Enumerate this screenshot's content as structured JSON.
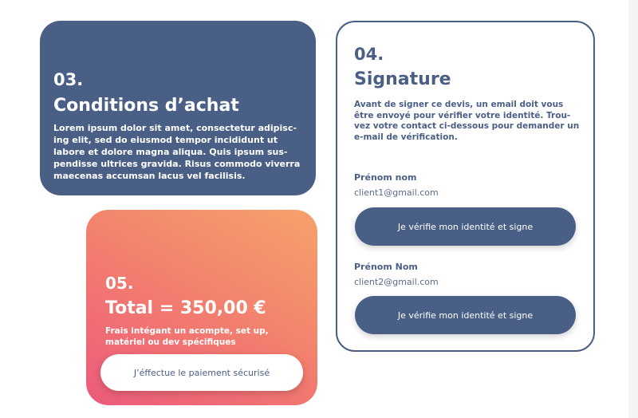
{
  "conditions": {
    "number": "03.",
    "title": "Conditions d’achat",
    "body": "Lorem ipsum dolor sit amet, consectetur adipisc-ing elit, sed do eiusmod tempor incididunt ut labore et dolore magna aliqua. Quis ipsum sus-pendisse ultrices gravida. Risus commodo viverra maecenas accumsan lacus vel facilisis."
  },
  "signature": {
    "number": "04.",
    "title": "Signature",
    "description": "Avant de signer ce devis, un email doit vous être envoyé pour vérifier votre identité. Trou-vez votre contact ci-dessous pour demander un e-mail de vérification.",
    "clients": [
      {
        "name": "Prénom nom",
        "email": "client1@gmail.com",
        "button_label": "Je vérifie mon identité et signe"
      },
      {
        "name": "Prénom Nom",
        "email": "client2@gmail.com",
        "button_label": "Je vérifie mon identité et signe"
      }
    ]
  },
  "total": {
    "number": "05.",
    "title": "Total = 350,00 €",
    "description": "Frais intégant un acompte, set up, matériel ou dev spécifiques",
    "pay_button_label": "J’éffectue le paiement sécurisé"
  },
  "colors": {
    "primary": "#4a5f86",
    "gradient_start": "#ec5a7c",
    "gradient_end": "#f5a36a",
    "background": "#ffffff"
  }
}
